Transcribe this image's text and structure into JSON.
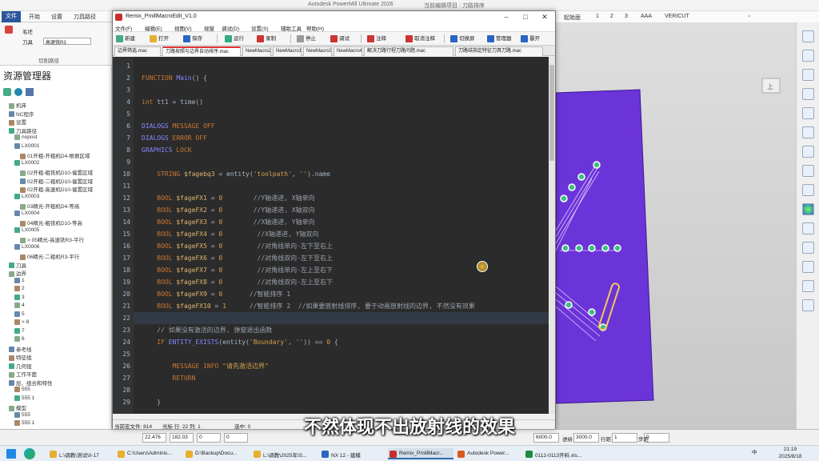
{
  "background_app": {
    "title": "Autodesk PowerMill Ultimate 2026",
    "title_extra": "当前编辑项目 : 刀路排序",
    "tabs": [
      "文件",
      "开始",
      "设置",
      "刀具路径",
      "刀具路径"
    ],
    "right_tabs": [
      "1",
      "2",
      "3",
      "AAA",
      "VERICUT"
    ],
    "ribbon_items": [
      "毛坯",
      "刀具",
      "高速铣R3",
      "切削路径"
    ],
    "explorer_title": "资源管理器",
    "tree": [
      "机床",
      "NC程序",
      "设置",
      "刀具路径",
      "nopost",
      "LX0001",
      "01开粗-开粗机D4-根据区域",
      "LX0002",
      "02开粗-粗铣机D10-偏置区域",
      "02开粗-二粗机D10-偏置区域",
      "02开粗-高速机D10-偏置区域",
      "LX0003",
      "03精光-开粗机D4-等高",
      "LX0004",
      "04精光-粗铣机D10-等高",
      "LX0005",
      "> 05精光-高速铣R3-平行",
      "LX0006",
      "06精光-二粗机R3-平行",
      "刀具",
      "边界",
      "1",
      "2",
      "3",
      "4",
      "5",
      "> 8",
      "7",
      "6",
      "参考线",
      "特征组",
      "几何组",
      "工作平面",
      "层、组合和特性",
      "555",
      "555 1",
      "模型",
      "555",
      "555 1"
    ],
    "status_values": [
      "22.476",
      "182.03",
      "0",
      "0",
      "6000.0",
      "3000.0",
      "1",
      "0"
    ],
    "status_labels": [
      "进给",
      "行距",
      "步距"
    ],
    "taskbar": [
      "L:\\调教\\测试\\II-17",
      "C:\\Users\\Adminis...",
      "D:\\Backup\\Docu...",
      "L:\\调教\\2025年\\S...",
      "NX 12 - 建模",
      "Remix_PmillMacr...",
      "Autodesk Power...",
      "0112-0113开料.xls..."
    ],
    "clock_time": "21:19",
    "clock_date": "2025/8/18"
  },
  "editor": {
    "title": "Remix_PmillMacroEdit_V1.0",
    "menu": [
      "文件(F)",
      "编辑(E)",
      "视图(V)",
      "视窗",
      "调试(D)",
      "设置(S)",
      "辅助工具",
      "帮助(H)"
    ],
    "toolbar": [
      "新建",
      "打开",
      "保存",
      "运行",
      "录制",
      "停止",
      "调试",
      "注释",
      "取消注释",
      "切换屏",
      "管理器",
      "暴开"
    ],
    "tabs": [
      "边界筛选.mac",
      "刀路按照与边界自动排序.mac",
      "NewMacro2",
      "NewMacro1",
      "NewMacro3",
      "NewMacro4",
      "解决刀路行程刀路问题.mac",
      "刀路结指定特征刀具刀路.mac"
    ],
    "status": [
      "当前宏文件: 814",
      "光标 行: 22  列: 1",
      "选中: 0"
    ]
  },
  "code_lines": [
    {
      "n": "1",
      "segs": []
    },
    {
      "n": "2",
      "segs": [
        [
          "kw",
          "FUNCTION "
        ],
        [
          "fn",
          "Main"
        ],
        [
          "pl",
          "() {"
        ]
      ]
    },
    {
      "n": "3",
      "segs": []
    },
    {
      "n": "4",
      "segs": [
        [
          "kw",
          "int "
        ],
        [
          "pl",
          "tt1 = time()"
        ]
      ]
    },
    {
      "n": "5",
      "segs": []
    },
    {
      "n": "6",
      "segs": [
        [
          "fn",
          "DIALOGS "
        ],
        [
          "kw",
          "MESSAGE OFF"
        ]
      ]
    },
    {
      "n": "7",
      "segs": [
        [
          "fn",
          "DIALOGS "
        ],
        [
          "kw",
          "ERROR OFF"
        ]
      ]
    },
    {
      "n": "8",
      "segs": [
        [
          "fn",
          "GRAPHICS "
        ],
        [
          "kw",
          "LOCK"
        ]
      ]
    },
    {
      "n": "9",
      "segs": []
    },
    {
      "n": "10",
      "segs": [
        [
          "pl",
          "    "
        ],
        [
          "kw",
          "STRING "
        ],
        [
          "var",
          "$fagebq3"
        ],
        [
          "pl",
          " = entity("
        ],
        [
          "str",
          "'toolpath'"
        ],
        [
          "pl",
          ", "
        ],
        [
          "str",
          "''"
        ],
        [
          "pl",
          ").name"
        ]
      ]
    },
    {
      "n": "11",
      "segs": []
    },
    {
      "n": "12",
      "segs": [
        [
          "pl",
          "    "
        ],
        [
          "kw",
          "BOOL "
        ],
        [
          "var",
          "$fageFX1"
        ],
        [
          "pl",
          " = "
        ],
        [
          "num",
          "0"
        ],
        [
          "cm",
          "        //Y轴递进, X轴单向"
        ]
      ]
    },
    {
      "n": "13",
      "segs": [
        [
          "pl",
          "    "
        ],
        [
          "kw",
          "BOOL "
        ],
        [
          "var",
          "$fageFX2"
        ],
        [
          "pl",
          " = "
        ],
        [
          "num",
          "0"
        ],
        [
          "cm",
          "        //Y轴递进, X轴双向"
        ]
      ]
    },
    {
      "n": "14",
      "segs": [
        [
          "pl",
          "    "
        ],
        [
          "kw",
          "BOOL "
        ],
        [
          "var",
          "$fageFX3"
        ],
        [
          "pl",
          " = "
        ],
        [
          "num",
          "0"
        ],
        [
          "cm",
          "        //X轴递进, Y轴单向"
        ]
      ]
    },
    {
      "n": "15",
      "segs": [
        [
          "pl",
          "    "
        ],
        [
          "kw",
          "BOOL "
        ],
        [
          "var",
          "$fageFX4"
        ],
        [
          "pl",
          " = "
        ],
        [
          "num",
          "0"
        ],
        [
          "cm",
          "         //X轴递进, Y轴双向"
        ]
      ]
    },
    {
      "n": "16",
      "segs": [
        [
          "pl",
          "    "
        ],
        [
          "kw",
          "BOOL "
        ],
        [
          "var",
          "$fageFX5"
        ],
        [
          "pl",
          " = "
        ],
        [
          "num",
          "0"
        ],
        [
          "cm",
          "         //对角线单向-左下至右上"
        ]
      ]
    },
    {
      "n": "17",
      "segs": [
        [
          "pl",
          "    "
        ],
        [
          "kw",
          "BOOL "
        ],
        [
          "var",
          "$fageFX6"
        ],
        [
          "pl",
          " = "
        ],
        [
          "num",
          "0"
        ],
        [
          "cm",
          "         //对角线双向-左下至右上"
        ]
      ]
    },
    {
      "n": "18",
      "segs": [
        [
          "pl",
          "    "
        ],
        [
          "kw",
          "BOOL "
        ],
        [
          "var",
          "$fageFX7"
        ],
        [
          "pl",
          " = "
        ],
        [
          "num",
          "0"
        ],
        [
          "cm",
          "         //对角线单向-左上至右下"
        ]
      ]
    },
    {
      "n": "19",
      "segs": [
        [
          "pl",
          "    "
        ],
        [
          "kw",
          "BOOL "
        ],
        [
          "var",
          "$fageFX8"
        ],
        [
          "pl",
          " = "
        ],
        [
          "num",
          "0"
        ],
        [
          "cm",
          "         //对角线双向-左上至右下"
        ]
      ]
    },
    {
      "n": "20",
      "segs": [
        [
          "pl",
          "    "
        ],
        [
          "kw",
          "BOOL "
        ],
        [
          "var",
          "$fageFX9"
        ],
        [
          "pl",
          " = "
        ],
        [
          "num",
          "0"
        ],
        [
          "cm",
          "       //智能排序 1"
        ]
      ]
    },
    {
      "n": "21",
      "segs": [
        [
          "pl",
          "    "
        ],
        [
          "kw",
          "BOOL "
        ],
        [
          "var",
          "$fageFX10"
        ],
        [
          "pl",
          " = "
        ],
        [
          "num",
          "1"
        ],
        [
          "cm",
          "      //智能排序 2  //如果要放射线排序, 要于动画放射线的边界, 不然没有效果"
        ]
      ]
    },
    {
      "n": "22",
      "segs": []
    },
    {
      "n": "23",
      "segs": [
        [
          "cm",
          "    // 如果没有激活的边界, 弹窗退出函数"
        ]
      ]
    },
    {
      "n": "24",
      "segs": [
        [
          "pl",
          "    "
        ],
        [
          "kw",
          "IF "
        ],
        [
          "fn",
          "ENTITY_EXISTS"
        ],
        [
          "pl",
          "(entity("
        ],
        [
          "str",
          "'Boundary'"
        ],
        [
          "pl",
          ", "
        ],
        [
          "str",
          "''"
        ],
        [
          "pl",
          ")) == "
        ],
        [
          "num",
          "0"
        ],
        [
          "pl",
          " {"
        ]
      ]
    },
    {
      "n": "25",
      "segs": []
    },
    {
      "n": "26",
      "segs": [
        [
          "pl",
          "        "
        ],
        [
          "kw",
          "MESSAGE INFO "
        ],
        [
          "str",
          "\"请先激活边界\""
        ]
      ]
    },
    {
      "n": "27",
      "segs": [
        [
          "pl",
          "        "
        ],
        [
          "kw",
          "RETURN"
        ]
      ]
    },
    {
      "n": "28",
      "segs": []
    },
    {
      "n": "29",
      "segs": [
        [
          "pl",
          "    }"
        ]
      ]
    }
  ],
  "subtitle": "不然体现不出放射线的效果",
  "colors": {
    "plate": "#6b34d8",
    "editor_bg": "#2b2b2b",
    "keyword": "#cc7832"
  }
}
